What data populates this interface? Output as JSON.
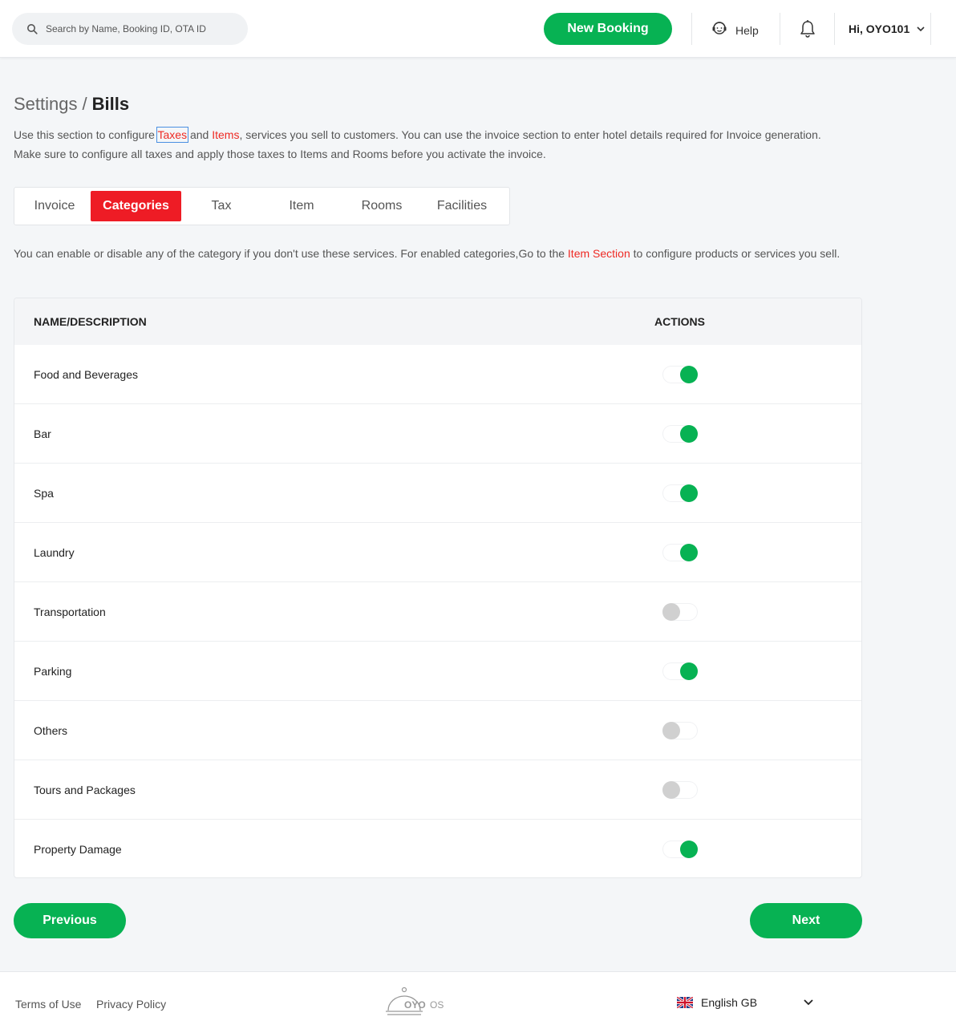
{
  "header": {
    "search_placeholder": "Search by Name, Booking ID, OTA ID",
    "new_booking_label": "New Booking",
    "help_label": "Help",
    "user_label": "Hi, OYO101"
  },
  "breadcrumb": {
    "parent": "Settings",
    "separator": "/",
    "current": "Bills"
  },
  "intro": {
    "part1": "Use this section to configure ",
    "taxes_link": "Taxes",
    "part2": " and ",
    "items_link": "Items",
    "part3": ", services you sell to customers. You can use the invoice section to enter hotel details required for Invoice generation. Make sure to configure all taxes and apply those taxes to Items and Rooms before you activate the invoice."
  },
  "tabs": [
    {
      "label": "Invoice",
      "active": false
    },
    {
      "label": "Categories",
      "active": true
    },
    {
      "label": "Tax",
      "active": false
    },
    {
      "label": "Item",
      "active": false
    },
    {
      "label": "Rooms",
      "active": false
    },
    {
      "label": "Facilities",
      "active": false
    }
  ],
  "categories_intro": {
    "part1": "You can enable or disable any of the category if you don't use these services. For enabled categories,Go to the ",
    "link": "Item Section",
    "part2": " to configure products or services you sell."
  },
  "table": {
    "col_name": "NAME/DESCRIPTION",
    "col_actions": "ACTIONS",
    "rows": [
      {
        "name": "Food and Beverages",
        "enabled": true
      },
      {
        "name": "Bar",
        "enabled": true
      },
      {
        "name": "Spa",
        "enabled": true
      },
      {
        "name": "Laundry",
        "enabled": true
      },
      {
        "name": "Transportation",
        "enabled": false
      },
      {
        "name": "Parking",
        "enabled": true
      },
      {
        "name": "Others",
        "enabled": false
      },
      {
        "name": "Tours and Packages",
        "enabled": false
      },
      {
        "name": "Property Damage",
        "enabled": true
      }
    ]
  },
  "nav": {
    "previous_label": "Previous",
    "next_label": "Next"
  },
  "footer": {
    "terms_label": "Terms of Use",
    "privacy_label": "Privacy Policy",
    "logo_text": "OYO",
    "logo_suffix": "OS",
    "language_label": "English GB"
  },
  "colors": {
    "brand_green": "#07b253",
    "brand_red": "#ee1c25",
    "link_red": "#ee2a24"
  }
}
